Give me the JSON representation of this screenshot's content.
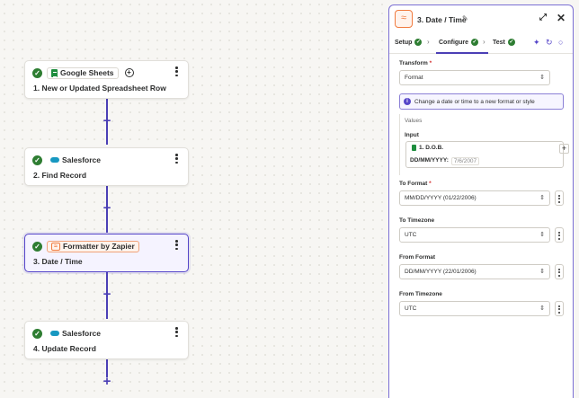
{
  "flow": {
    "steps": [
      {
        "app": "Google Sheets",
        "title": "1. New or Updated Spreadsheet Row"
      },
      {
        "app": "Salesforce",
        "title": "2. Find Record"
      },
      {
        "app": "Formatter by Zapier",
        "title": "3. Date / Time"
      },
      {
        "app": "Salesforce",
        "title": "4. Update Record"
      }
    ],
    "add_label": "+"
  },
  "panel": {
    "title": "3. Date / Time",
    "tabs": [
      {
        "label": "Setup",
        "done": true
      },
      {
        "label": "Configure",
        "done": true,
        "active": true
      },
      {
        "label": "Test",
        "done": true
      }
    ],
    "transform": {
      "label": "Transform",
      "required": "*",
      "value": "Format"
    },
    "info": "Change a date or time to a new format or style",
    "values": {
      "title": "Values",
      "input_label": "Input",
      "input_field": "1. D.O.B.",
      "dob_label": "DD/MM/YYYY:",
      "dob_value": "7/6/2007"
    },
    "to_format": {
      "label": "To Format",
      "required": "*",
      "value": "MM/DD/YYYY (01/22/2006)"
    },
    "to_timezone": {
      "label": "To Timezone",
      "value": "UTC"
    },
    "from_format": {
      "label": "From Format",
      "value": "DD/MM/YYYY (22/01/2006)"
    },
    "from_timezone": {
      "label": "From Timezone",
      "value": "UTC"
    }
  },
  "colors": {
    "accent": "#4b3fb5",
    "success": "#2e7d32",
    "formatter": "#f07b3f"
  }
}
